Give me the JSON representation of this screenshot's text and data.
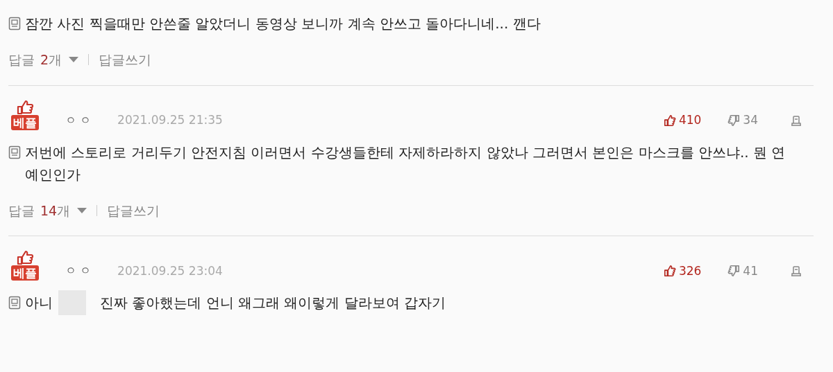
{
  "comments": [
    {
      "body": [
        {
          "kind": "text",
          "text": "잠깐 사진 찍을때만 안쓴줄 알았더니 동영상 보니까 계속 안쓰고 돌아다니네... 깬다"
        }
      ],
      "replies": {
        "label": "답글",
        "count": "2",
        "unit": "개"
      },
      "write": "답글쓰기"
    },
    {
      "header": {
        "badge": "베플",
        "author": "ㅇ ㅇ",
        "date": "2021.09.25 21:35",
        "likes": "410",
        "dislikes": "34"
      },
      "body": [
        {
          "kind": "text",
          "text": "저번에 스토리로 거리두기 안전지침 이러면서 수강생들한테 자제하라하지 않았나 그러면서 본인은 마스크를 안쓰냐.. 뭔 연예인인가"
        }
      ],
      "replies": {
        "label": "답글",
        "count": "14",
        "unit": "개"
      },
      "write": "답글쓰기"
    },
    {
      "header": {
        "badge": "베플",
        "author": "ㅇ ㅇ",
        "date": "2021.09.25 23:04",
        "likes": "326",
        "dislikes": "41"
      },
      "body": [
        {
          "kind": "text",
          "text": "아니"
        },
        {
          "kind": "redacted"
        },
        {
          "kind": "text",
          "text": "진짜 좋아했는데 언니 왜그래 왜이렇게 달라보여 갑자기"
        }
      ]
    }
  ]
}
